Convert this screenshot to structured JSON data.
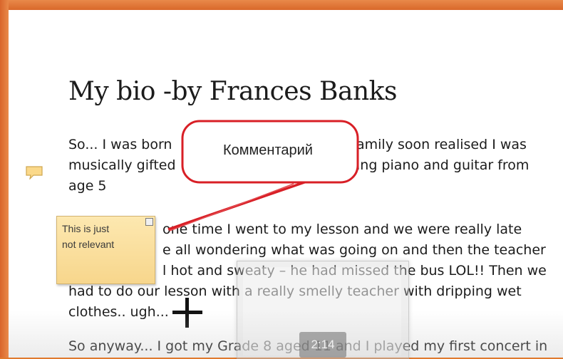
{
  "document": {
    "title": "My bio -by Frances Banks",
    "paragraphs": [
      [
        "So... I was born",
        "amily soon realised I was",
        "musically gifted",
        "ing piano and guitar from",
        "age 5"
      ],
      [
        "one time I went to my lesson and we were really late",
        "e all wondering what was going on and then the teacher",
        "l hot and sweaty – he had missed the bus LOL!! Then we",
        "had to do our lesson with a really smelly teacher with dripping wet",
        "clothes.. ugh..."
      ],
      [
        "So anyway... I got my Grade 8 aged 11 and I played my first concert in"
      ]
    ]
  },
  "comment": {
    "sticky_line1": "This is just",
    "sticky_line2": "not relevant"
  },
  "callout": {
    "label": "Комментарий",
    "border_color": "#d81f26"
  },
  "video": {
    "timer": "2:14"
  },
  "colors": {
    "frame": "#e07a2e",
    "sticky": "#f9dc97",
    "callout_red": "#d81f26"
  }
}
